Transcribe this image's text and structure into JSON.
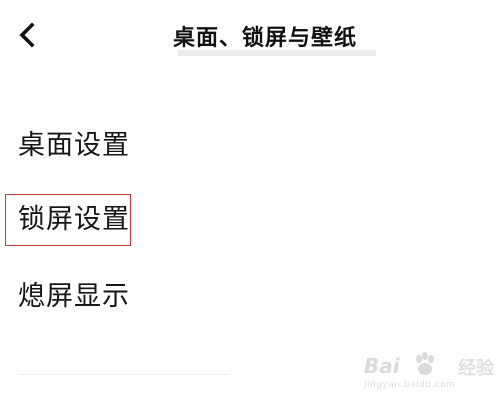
{
  "header": {
    "back_icon": "chevron-left-icon",
    "title": "桌面、锁屏与壁纸"
  },
  "menu": {
    "items": [
      {
        "label": "桌面设置"
      },
      {
        "label": "锁屏设置",
        "highlighted": true
      },
      {
        "label": "熄屏显示"
      }
    ]
  },
  "highlight": {
    "color": "#c43a3a"
  },
  "watermark": {
    "main": "Bai",
    "paw_icon": "baidu-paw-icon",
    "sub": "经验",
    "url": "jingyan.baidu.com"
  }
}
